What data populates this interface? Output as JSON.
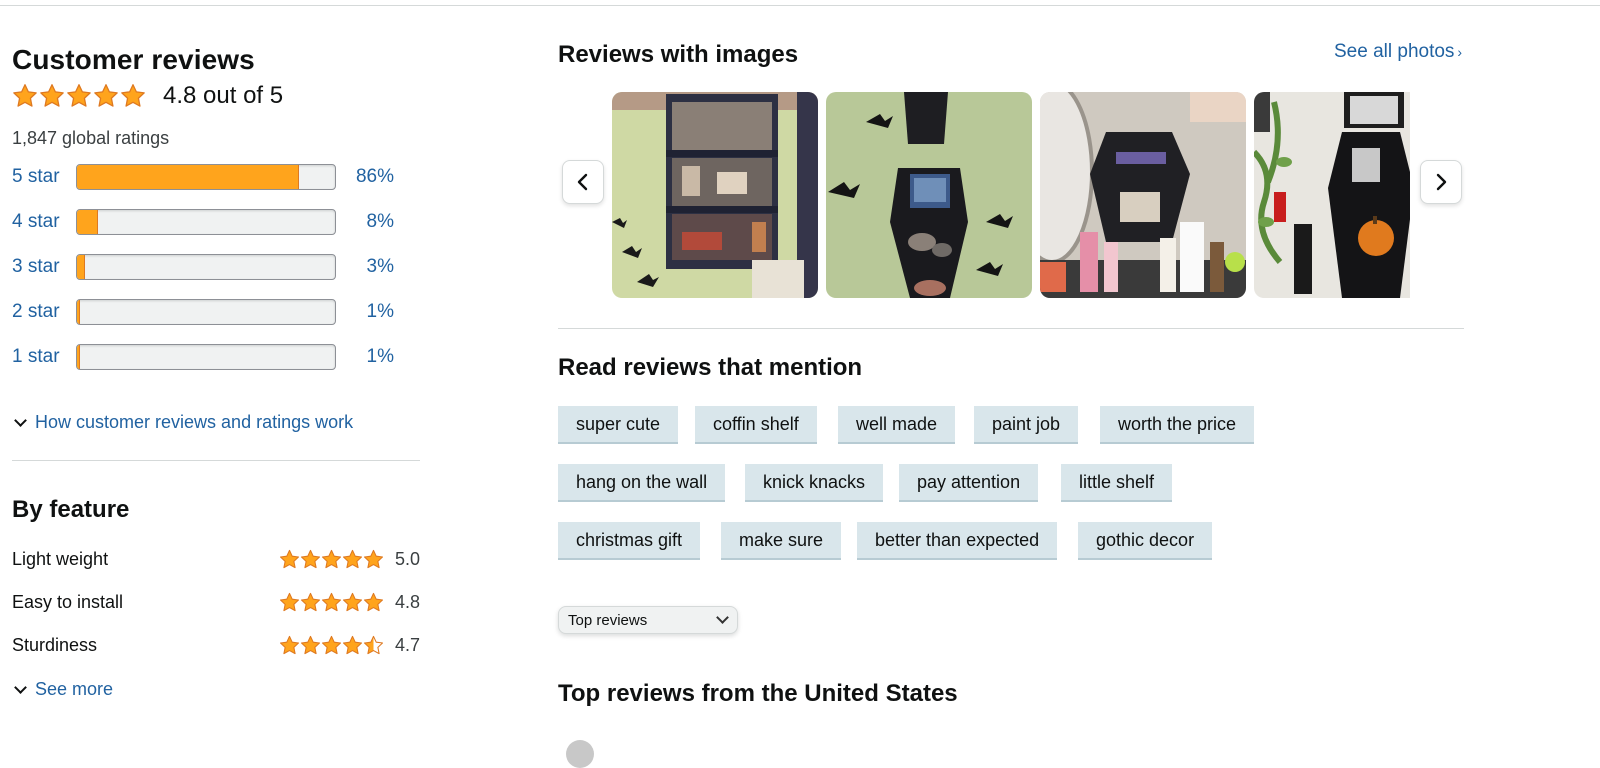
{
  "customer_reviews": {
    "title": "Customer reviews",
    "average_rating": 4.8,
    "average_text": "4.8 out of 5",
    "global_ratings": "1,847 global ratings",
    "histogram": [
      {
        "label": "5 star",
        "percent_text": "86%",
        "percent": 86
      },
      {
        "label": "4 star",
        "percent_text": "8%",
        "percent": 8
      },
      {
        "label": "3 star",
        "percent_text": "3%",
        "percent": 3
      },
      {
        "label": "2 star",
        "percent_text": "1%",
        "percent": 1
      },
      {
        "label": "1 star",
        "percent_text": "1%",
        "percent": 1
      }
    ],
    "how_link": "How customer reviews and ratings work"
  },
  "by_feature": {
    "title": "By feature",
    "features": [
      {
        "name": "Light weight",
        "rating": 5.0,
        "rating_text": "5.0"
      },
      {
        "name": "Easy to install",
        "rating": 4.8,
        "rating_text": "4.8"
      },
      {
        "name": "Sturdiness",
        "rating": 4.7,
        "rating_text": "4.7"
      }
    ],
    "see_more": "See more"
  },
  "reviews_with_images": {
    "title": "Reviews with images",
    "see_all": "See all photos",
    "see_all_arrow": "›",
    "thumbnails": [
      "photo-coffin-shelf-wall",
      "photo-coffin-shelf-bats",
      "photo-coffin-shelf-vanity",
      "photo-coffin-shelf-pumpkin"
    ]
  },
  "read_reviews": {
    "title": "Read reviews that mention",
    "chips": [
      [
        "super cute",
        "coffin shelf",
        "well made",
        "paint job",
        "worth the price"
      ],
      [
        "hang on the wall",
        "knick knacks",
        "pay attention",
        "little shelf"
      ],
      [
        "christmas gift",
        "make sure",
        "better than expected",
        "gothic decor"
      ]
    ]
  },
  "sort": {
    "selected": "Top reviews"
  },
  "top_reviews": {
    "title": "Top reviews from the United States"
  },
  "colors": {
    "star": "#ffa41c",
    "star_outline": "#de7921",
    "link": "#2162a1",
    "chip": "#d9e6eb"
  },
  "icons": {
    "prev": "chevron-left-icon",
    "next": "chevron-right-icon",
    "expand": "chevron-down-icon",
    "star": "star-icon"
  }
}
